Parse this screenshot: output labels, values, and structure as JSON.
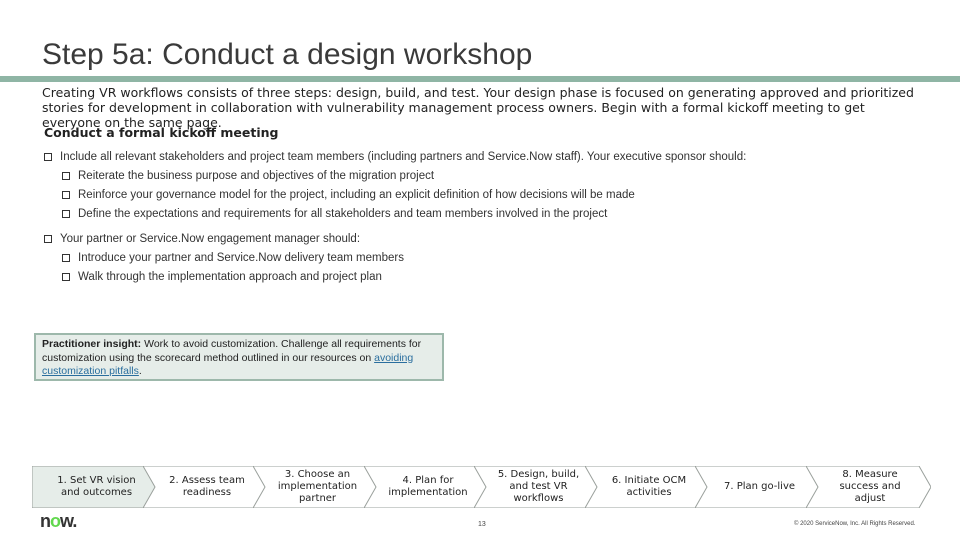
{
  "title": "Step 5a: Conduct a design workshop",
  "intro": "Creating VR workflows consists of three steps: design, build, and test. Your design phase is focused on generating approved and prioritized stories for development in collaboration with vulnerability management process owners. Begin with a formal kickoff meeting to get everyone on the same page.",
  "subhead": "Conduct a formal kickoff meeting",
  "bullets": [
    "Include all relevant stakeholders and project team members (including partners and Service.Now staff). Your executive sponsor should:",
    "Reiterate the business purpose and objectives of the migration project",
    "Reinforce your governance model for the project, including an explicit definition of how decisions will be made",
    "Define the expectations and requirements for all stakeholders and team members involved in the project",
    "Your partner or Service.Now engagement manager should:",
    "Introduce your partner and Service.Now delivery team members",
    "Walk through the implementation approach and project plan"
  ],
  "insight": {
    "label": "Practitioner insight:",
    "text": " Work to avoid customization. Challenge all requirements for customization using the scorecard method outlined in our resources on ",
    "link": "avoiding customization pitfalls",
    "end": "."
  },
  "steps": [
    {
      "label": "1. Set VR vision and outcomes",
      "fill": "#ffffff"
    },
    {
      "label": "2. Assess team readiness",
      "fill": "#ffffff"
    },
    {
      "label": "3. Choose an implementation partner",
      "fill": "#ffffff"
    },
    {
      "label": "4. Plan for implementation",
      "fill": "#ffffff"
    },
    {
      "label": "5. Design, build, and test VR workflows",
      "fill": "#ffffff"
    },
    {
      "label": "6. Initiate OCM activities",
      "fill": "#ffffff"
    },
    {
      "label": "7. Plan go-live",
      "fill": "#ffffff"
    },
    {
      "label": "8. Measure success and adjust",
      "fill": "#ffffff"
    }
  ],
  "colors": {
    "accent": "#8fb5a5",
    "step_fill_first": "#e6ede9",
    "logo_dot": "#62d84e"
  },
  "logo": {
    "prefix": "n",
    "dot": "o",
    "suffix": "w."
  },
  "page_number": "13",
  "copyright": "© 2020 ServiceNow, Inc. All Rights Reserved."
}
